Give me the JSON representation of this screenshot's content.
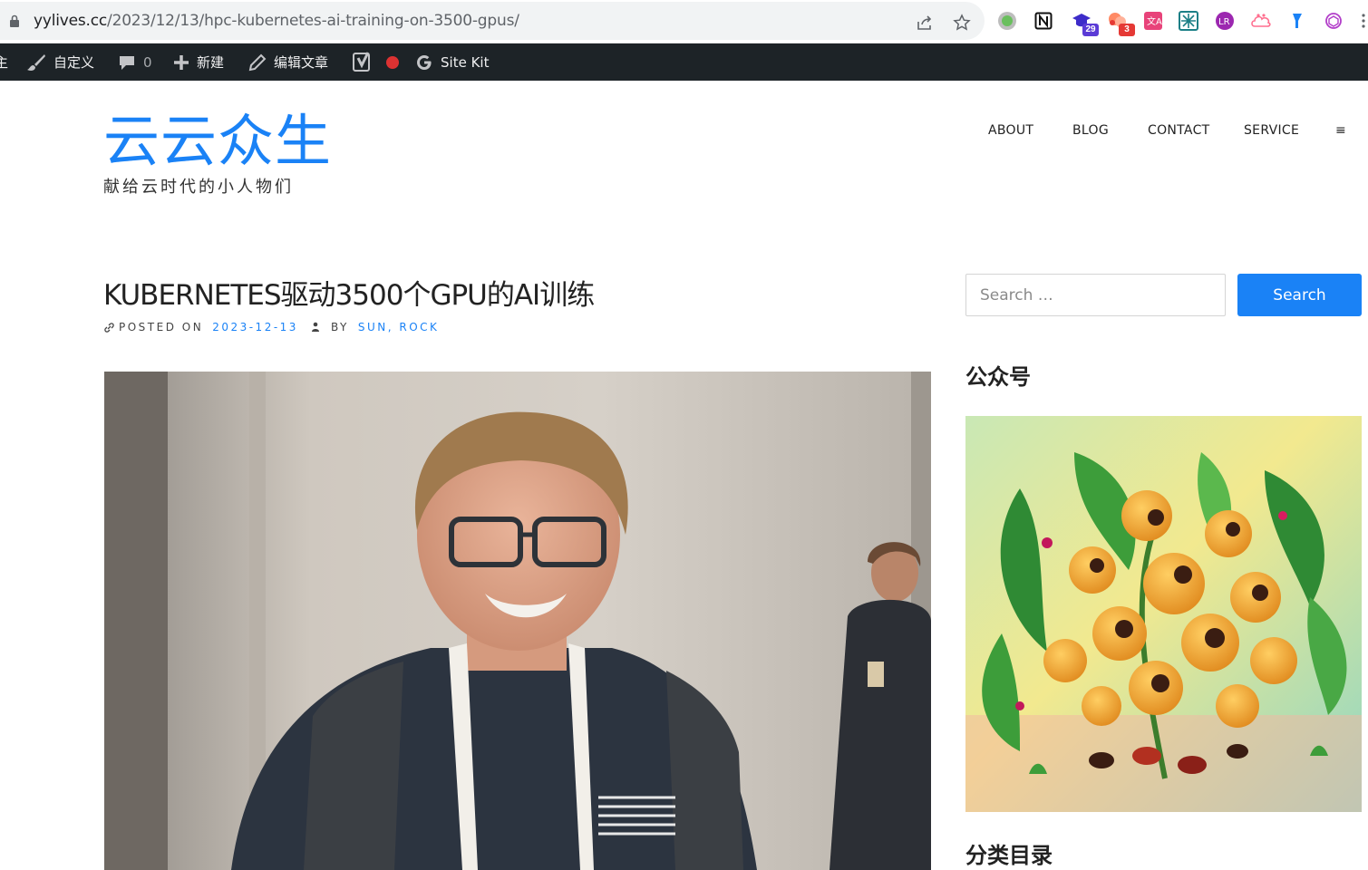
{
  "browser": {
    "url_domain": "yylives.cc",
    "url_path": "/2023/12/13/hpc-kubernetes-ai-training-on-3500-gpus/",
    "extension_badges": {
      "ext_a": "29",
      "ext_b": "3"
    }
  },
  "admin_bar": {
    "cut_label": "主",
    "customize_label": "自定义",
    "comments_count": "0",
    "new_label": "新建",
    "edit_post_label": "编辑文章",
    "site_kit_label": "Site Kit"
  },
  "header": {
    "site_title": "云云众生",
    "tagline": "献给云时代的小人物们",
    "nav": [
      "ABOUT",
      "BLOG",
      "CONTACT",
      "SERVICE"
    ],
    "menu_toggle_label": "≡"
  },
  "post": {
    "title": "KUBERNETES驱动3500个GPU的AI训练",
    "posted_on_label": "POSTED ON",
    "date": "2023-12-13",
    "by_label": "BY",
    "author": "SUN, ROCK"
  },
  "sidebar": {
    "search_placeholder": "Search …",
    "search_button_label": "Search",
    "widget1_title": "公众号",
    "widget2_title": "分类目录"
  },
  "colors": {
    "accent": "#1a82f6",
    "admin_bar_bg": "#1d2327",
    "badge_purple": "#5b3bd6",
    "badge_red": "#e53935"
  }
}
